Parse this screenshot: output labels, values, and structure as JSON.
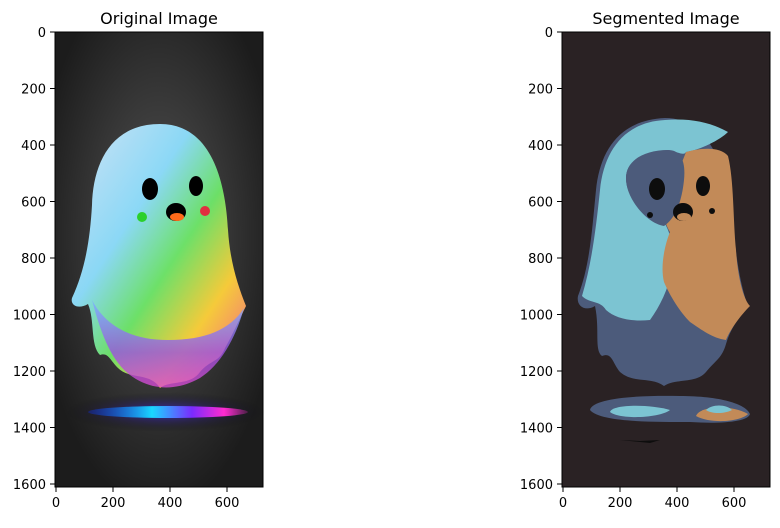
{
  "panels": [
    {
      "title": "Original Image",
      "image_description": "glowing rainbow cartoon ghost on a dark background with a colorful light pool beneath",
      "x_ticks": [
        "0",
        "200",
        "400",
        "600"
      ],
      "y_ticks": [
        "0",
        "200",
        "400",
        "600",
        "800",
        "1000",
        "1200",
        "1400",
        "1600"
      ]
    },
    {
      "title": "Segmented Image",
      "image_description": "color-quantized segmentation of the ghost into slate blue, light cyan, tan and dark regions",
      "x_ticks": [
        "0",
        "200",
        "400",
        "600"
      ],
      "y_ticks": [
        "0",
        "200",
        "400",
        "600",
        "800",
        "1000",
        "1200",
        "1400",
        "1600"
      ]
    }
  ],
  "colors": {
    "original_bg": "#1c1c1c",
    "seg_bg": "#2a2224",
    "seg_slate": "#4c5b7b",
    "seg_cyan": "#7cc4d2",
    "seg_tan": "#c28a58",
    "seg_dark": "#0d0d0d"
  }
}
